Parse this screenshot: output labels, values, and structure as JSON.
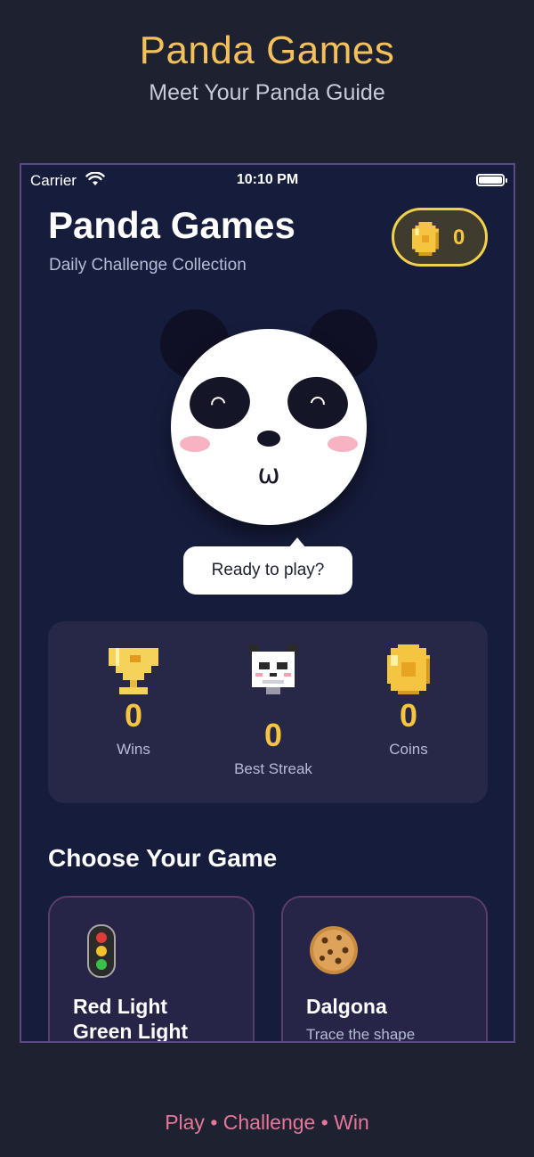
{
  "promo": {
    "title": "Panda Games",
    "subtitle": "Meet Your Panda Guide",
    "footer": "Play • Challenge • Win"
  },
  "status_bar": {
    "carrier": "Carrier",
    "time": "10:10 PM",
    "icons": [
      "wifi-icon",
      "battery-icon"
    ]
  },
  "header": {
    "title": "Panda Games",
    "subtitle": "Daily Challenge Collection",
    "coins": "0",
    "coin_icon": "coin-icon"
  },
  "panda": {
    "mouth": "ω",
    "speech": "Ready to play?"
  },
  "stats": [
    {
      "label": "Wins",
      "value": "0",
      "icon": "trophy-icon"
    },
    {
      "label": "Best Streak",
      "value": "0",
      "icon": "panda-pixel-icon"
    },
    {
      "label": "Coins",
      "value": "0",
      "icon": "coin-icon"
    }
  ],
  "games_section": {
    "title": "Choose Your Game",
    "games": [
      {
        "name": "Red Light\nGreen Light",
        "icon": "traffic-light-icon",
        "description": ""
      },
      {
        "name": "Dalgona",
        "icon": "cookie-icon",
        "description": "Trace the shape"
      }
    ]
  },
  "colors": {
    "background": "#1e2130",
    "phone_background": "#161d3c",
    "accent_gold": "#f5c542",
    "promo_title": "#f5c05a",
    "footer_pink": "#e8769a"
  }
}
